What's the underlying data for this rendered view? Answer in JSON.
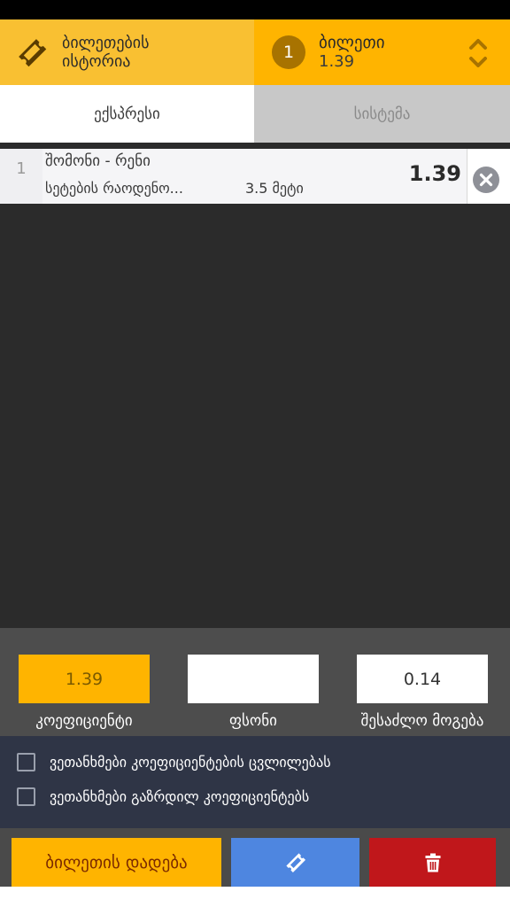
{
  "header": {
    "history_label_line1": "ბილეთების",
    "history_label_line2": "ისტორია",
    "betslip_count": "1",
    "betslip_title": "ბილეთი",
    "betslip_total_odds": "1.39"
  },
  "tabs": [
    {
      "label": "ექსპრესი",
      "active": true
    },
    {
      "label": "სისტემა",
      "active": false
    }
  ],
  "selections": [
    {
      "index": "1",
      "match": "შომონი - რენი",
      "market": "სეტების რაოდენო...",
      "outcome": "3.5 მეტი",
      "odds": "1.39"
    }
  ],
  "bet_controls": {
    "odds_value": "1.39",
    "stake_value": "",
    "possible_win_value": "0.14",
    "odds_caption": "კოეფიციენტი",
    "stake_caption": "ფსონი",
    "possible_win_caption": "შესაძლო მოგება"
  },
  "agreements": [
    {
      "label": "ვეთანხმები კოეფიციენტების ცვლილებას",
      "checked": false
    },
    {
      "label": "ვეთანხმები გაზრდილ კოეფიციენტებს",
      "checked": false
    }
  ],
  "actions": {
    "place_bet_label": "ბილეთის დადება"
  },
  "icons": {
    "history": "ticket-icon",
    "collapse": "chevron-up-down-icon",
    "remove": "close-circle-icon",
    "ticket_button": "ticket-icon",
    "delete_button": "trash-icon"
  },
  "colors": {
    "accent": "#ffb400",
    "history_bg": "#f9c032",
    "badge": "#a87300",
    "danger": "#c0171b",
    "primary": "#4e86e0",
    "dark_bg": "#2b2b2b"
  }
}
